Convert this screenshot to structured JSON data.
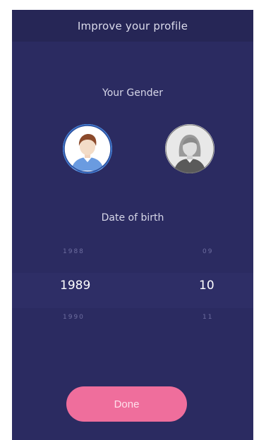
{
  "header": {
    "title": "Improve your profile"
  },
  "gender": {
    "label": "Your Gender",
    "options": [
      {
        "icon": "male-avatar-icon",
        "selected": true
      },
      {
        "icon": "female-avatar-icon",
        "selected": false
      }
    ]
  },
  "dob": {
    "label": "Date of birth",
    "years": [
      "1988",
      "1989",
      "1990"
    ],
    "months": [
      "09",
      "10",
      "11"
    ],
    "selected_year": "1989",
    "selected_month": "10"
  },
  "done_button": {
    "label": "Done"
  },
  "colors": {
    "background": "#2b2b61",
    "header": "#262656",
    "accent": "#ef6e9c",
    "selected_ring": "#3b7bd6"
  }
}
